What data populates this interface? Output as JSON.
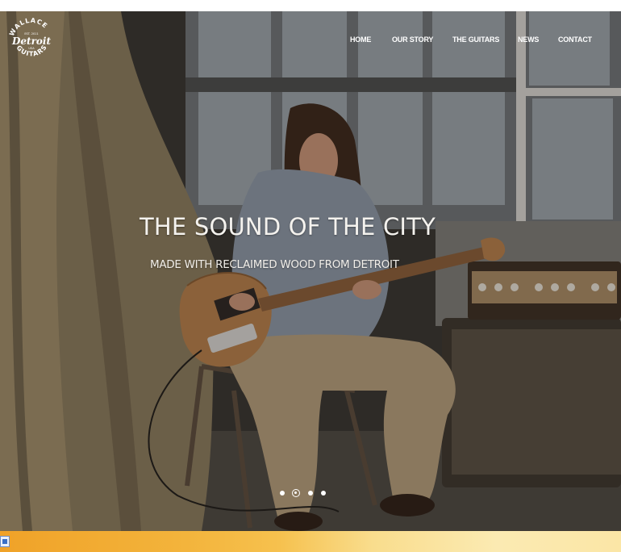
{
  "logo": {
    "top_text": "WALLACE",
    "middle_text": "Detroit",
    "est_text": "EST. 2011",
    "country_text": "USA",
    "bottom_text": "GUITARS"
  },
  "nav": {
    "items": [
      {
        "label": "HOME"
      },
      {
        "label": "OUR STORY"
      },
      {
        "label": "THE GUITARS"
      },
      {
        "label": "NEWS"
      },
      {
        "label": "CONTACT"
      }
    ]
  },
  "hero": {
    "title": "THE SOUND OF THE CITY",
    "subtitle": "MADE WITH RECLAIMED WOOD FROM DETROIT"
  },
  "carousel": {
    "slide_count": 4,
    "active_index": 1
  },
  "colors": {
    "nav_text": "#ffffff",
    "hero_text": "#f4f2ee",
    "bottom_band_start": "#f0a228",
    "bottom_band_end": "#fbe6a6"
  },
  "icons": {
    "taskbar": "document-icon"
  }
}
